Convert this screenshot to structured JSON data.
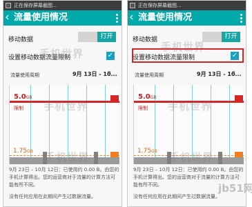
{
  "screens": [
    {
      "status_text": "正在保存屏幕截图...",
      "title": "流量使用情况",
      "mobile_data_label": "移动数据",
      "toggle_label": "打开",
      "limit_label": "设置移动数据流量限制",
      "limit_checked": true,
      "highlight_limit": false,
      "cycle_label": "流量使用周期",
      "cycle_value": "9月 13日 - 10...",
      "chart": {
        "limit_value": "5.0",
        "limit_unit": "GB",
        "limit_tag": "限制",
        "warning_value": "1.75",
        "warning_unit": "GB"
      },
      "summary": "9月 23日 – 10月 12日：已使用约 0.00 B。由您的手机计算得出。您的运营商对于流量的计算方法可能有所不同。",
      "no_app": "没有任何应用在此期间产生过数据流量。",
      "watermarks": [
        "手机世界",
        "手机世界",
        "手机世界"
      ]
    },
    {
      "status_text": "正在保存屏幕截图...",
      "title": "流量使用情况",
      "mobile_data_label": "移动数据",
      "toggle_label": "打开",
      "limit_label": "设置移动数据流量限制",
      "limit_checked": true,
      "highlight_limit": true,
      "cycle_label": "流量使用周期",
      "cycle_value": "9月 13日 - 10...",
      "chart": {
        "limit_value": "5.0",
        "limit_unit": "GB",
        "limit_tag": "限制",
        "warning_value": "1.75",
        "warning_unit": "GB"
      },
      "summary": "9月 23日 – 10月 12日：已使用约 0.00 B。由您的手机计算得出。您的运营商对于流量的计算方法可能有所不同。",
      "no_app": "没有任何应用在此期间产生过数据流量。",
      "watermarks": [
        "手机世界",
        "手机世界",
        "手机世界"
      ]
    }
  ],
  "corner_watermark": "jb51网",
  "colors": {
    "appbar": "#00a9a9",
    "toggle_on": "#14a5a5",
    "limit": "#d32626",
    "warning": "#ef7f22",
    "checkbox": "#18a2c2"
  }
}
